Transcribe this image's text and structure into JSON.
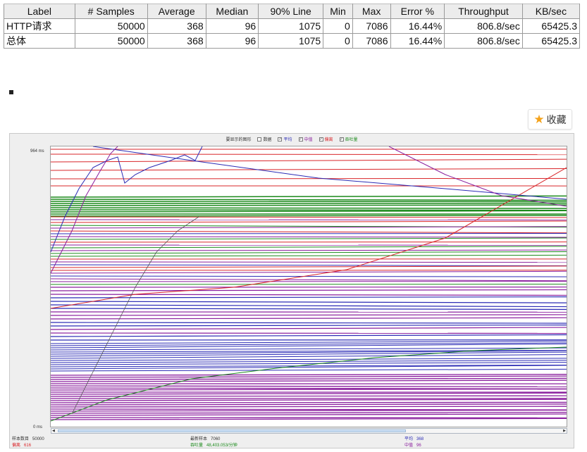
{
  "summary_table": {
    "columns": [
      "Label",
      "# Samples",
      "Average",
      "Median",
      "90% Line",
      "Min",
      "Max",
      "Error %",
      "Throughput",
      "KB/sec"
    ],
    "rows": [
      [
        "HTTP请求",
        "50000",
        "368",
        "96",
        "1075",
        "0",
        "7086",
        "16.44%",
        "806.8/sec",
        "65425.3"
      ],
      [
        "总体",
        "50000",
        "368",
        "96",
        "1075",
        "0",
        "7086",
        "16.44%",
        "806.8/sec",
        "65425.3"
      ]
    ]
  },
  "favorite_button": {
    "label": "收藏",
    "icon": "star-icon"
  },
  "graph": {
    "legend_title": "要显示的图形",
    "legend_items": [
      {
        "label": "数据",
        "checked": false,
        "color": "#333333"
      },
      {
        "label": "平均",
        "checked": true,
        "color": "#2b2bb5"
      },
      {
        "label": "中值",
        "checked": true,
        "color": "#8a1f9e"
      },
      {
        "label": "偏离",
        "checked": true,
        "color": "#d9262a"
      },
      {
        "label": "吞吐量",
        "checked": true,
        "color": "#1c8a1c"
      }
    ],
    "y_max_label": "964 ms",
    "y_min_label": "0 ms",
    "stats": {
      "samples": {
        "label": "样本数目",
        "value": "50000"
      },
      "deviation": {
        "label": "偏离",
        "value": "616"
      },
      "latest": {
        "label": "最新样本",
        "value": "7060"
      },
      "throughput": {
        "label": "吞吐量",
        "value": "48,403.053/分钟"
      },
      "average": {
        "label": "平均",
        "value": "368"
      },
      "median": {
        "label": "中值",
        "value": "96"
      }
    },
    "colors": {
      "average": "#2b2bb5",
      "median": "#8a1f9e",
      "deviation": "#d9262a",
      "throughput": "#1c8a1c",
      "data": "#555555"
    }
  }
}
